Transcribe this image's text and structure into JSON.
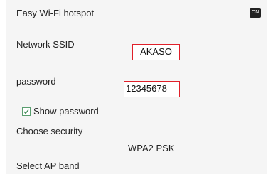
{
  "settings": {
    "hotspot": {
      "label": "Easy Wi-Fi hotspot",
      "toggle_text": "ON"
    },
    "ssid": {
      "label": "Network SSID",
      "value": "AKASO"
    },
    "password": {
      "label": "password",
      "value": "12345678"
    },
    "show_password": {
      "label": "Show password",
      "checked": true
    },
    "security": {
      "label": "Choose security",
      "value": "WPA2 PSK"
    },
    "ap_band": {
      "label": "Select AP band"
    }
  }
}
